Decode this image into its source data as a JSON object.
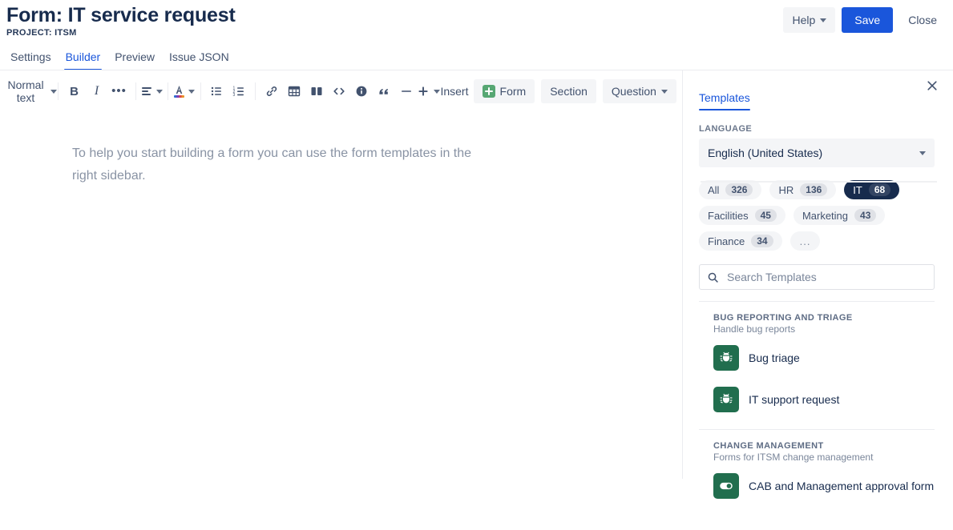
{
  "header": {
    "title": "Form: IT service request",
    "project": "PROJECT: ITSM",
    "help_label": "Help",
    "save_label": "Save",
    "close_label": "Close"
  },
  "tabs": [
    {
      "label": "Settings",
      "active": false
    },
    {
      "label": "Builder",
      "active": true
    },
    {
      "label": "Preview",
      "active": false
    },
    {
      "label": "Issue JSON",
      "active": false
    }
  ],
  "toolbar": {
    "text_style": "Normal text",
    "bold": "B",
    "italic": "I",
    "more_formatting": "•••",
    "insert_label": "Insert",
    "form_label": "Form",
    "section_label": "Section",
    "question_label": "Question",
    "icons": [
      "bullet-list-icon",
      "numbered-list-icon",
      "link-icon",
      "table-icon",
      "layout-columns-icon",
      "code-icon",
      "info-panel-icon",
      "quote-icon",
      "divider-icon",
      "add-more-icon"
    ]
  },
  "editor": {
    "placeholder": "To help you start building a form you can use the form templates in the right sidebar."
  },
  "sidebar": {
    "tab_label": "Templates",
    "language_label": "LANGUAGE",
    "language_value": "English (United States)",
    "search_placeholder": "Search Templates",
    "categories": [
      {
        "label": "All",
        "count": "326",
        "selected": false
      },
      {
        "label": "HR",
        "count": "136",
        "selected": false
      },
      {
        "label": "IT",
        "count": "68",
        "selected": true
      },
      {
        "label": "Facilities",
        "count": "45",
        "selected": false
      },
      {
        "label": "Marketing",
        "count": "43",
        "selected": false
      },
      {
        "label": "Finance",
        "count": "34",
        "selected": false
      }
    ],
    "more_label": "...",
    "groups": [
      {
        "title": "BUG REPORTING AND TRIAGE",
        "description": "Handle bug reports",
        "items": [
          {
            "name": "Bug triage",
            "icon": "bug-icon"
          },
          {
            "name": "IT support request",
            "icon": "bug-icon"
          }
        ]
      },
      {
        "title": "CHANGE MANAGEMENT",
        "description": "Forms for ITSM change management",
        "items": [
          {
            "name": "CAB and Management approval form",
            "icon": "toggle-icon"
          }
        ]
      }
    ]
  },
  "colors": {
    "accent": "#1a56db",
    "title": "#172b4d",
    "green": "#216e4e",
    "muted": "#7a869a"
  }
}
